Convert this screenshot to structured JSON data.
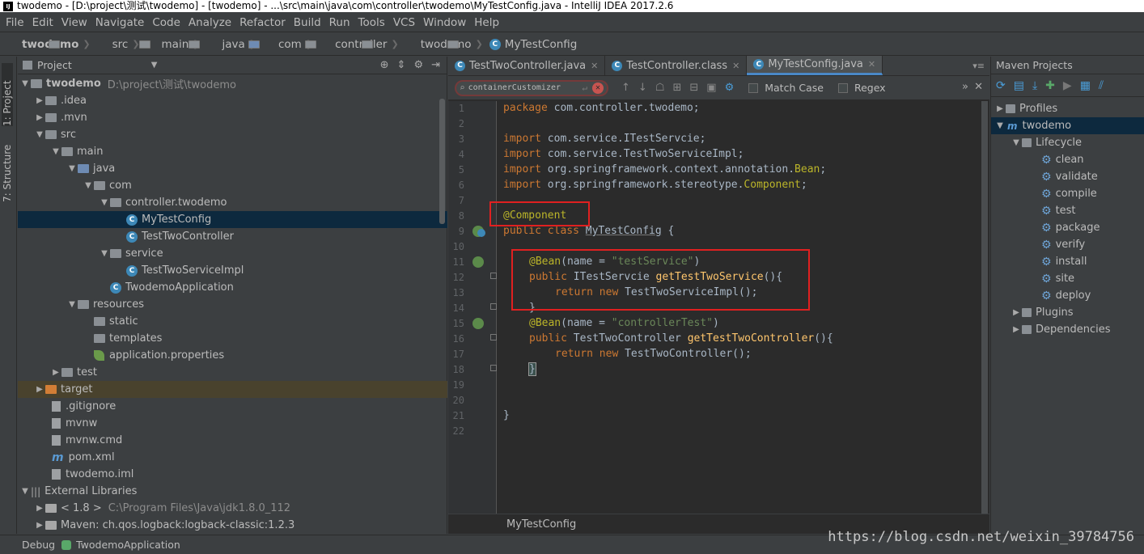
{
  "window": {
    "title": "twodemo - [D:\\project\\测试\\twodemo] - [twodemo] - ...\\src\\main\\java\\com\\controller\\twodemo\\MyTestConfig.java - IntelliJ IDEA 2017.2.6"
  },
  "menu": [
    "File",
    "Edit",
    "View",
    "Navigate",
    "Code",
    "Analyze",
    "Refactor",
    "Build",
    "Run",
    "Tools",
    "VCS",
    "Window",
    "Help"
  ],
  "breadcrumbs": [
    "twodemo",
    "src",
    "main",
    "java",
    "com",
    "controller",
    "twodemo",
    "MyTestConfig"
  ],
  "left_strip": {
    "project_tab": "1: Project",
    "structure_tab": "7: Structure"
  },
  "project_panel": {
    "title": "Project",
    "tree": [
      {
        "label": "twodemo",
        "extra": "D:\\project\\测试\\twodemo"
      },
      {
        "label": ".idea"
      },
      {
        "label": ".mvn"
      },
      {
        "label": "src"
      },
      {
        "label": "main"
      },
      {
        "label": "java"
      },
      {
        "label": "com"
      },
      {
        "label": "controller.twodemo"
      },
      {
        "label": "MyTestConfig"
      },
      {
        "label": "TestTwoController"
      },
      {
        "label": "service"
      },
      {
        "label": "TestTwoServiceImpl"
      },
      {
        "label": "TwodemoApplication"
      },
      {
        "label": "resources"
      },
      {
        "label": "static"
      },
      {
        "label": "templates"
      },
      {
        "label": "application.properties"
      },
      {
        "label": "test"
      },
      {
        "label": "target"
      },
      {
        "label": ".gitignore"
      },
      {
        "label": "mvnw"
      },
      {
        "label": "mvnw.cmd"
      },
      {
        "label": "pom.xml"
      },
      {
        "label": "twodemo.iml"
      },
      {
        "label": "External Libraries"
      },
      {
        "label": "< 1.8 >",
        "extra": "C:\\Program Files\\Java\\jdk1.8.0_112"
      },
      {
        "label": "Maven: ch.qos.logback:logback-classic:1.2.3"
      }
    ]
  },
  "editor": {
    "tabs": [
      "TestTwoController.java",
      "TestController.class",
      "MyTestConfig.java"
    ],
    "active_tab": "MyTestConfig.java",
    "search": {
      "query": "containerCustomizer",
      "match_case_label": "Match Case",
      "regex_label": "Regex"
    },
    "line_numbers": [
      "1",
      "2",
      "3",
      "4",
      "5",
      "6",
      "7",
      "8",
      "9",
      "10",
      "11",
      "12",
      "13",
      "14",
      "15",
      "16",
      "17",
      "18",
      "19",
      "20",
      "21",
      "22"
    ],
    "lines": {
      "l1_kw": "package",
      "l1_rest": " com.controller.twodemo;",
      "l3_kw": "import",
      "l3_rest": " com.service.ITestServcie;",
      "l4_kw": "import",
      "l4_rest": " com.service.TestTwoServiceImpl;",
      "l5_kw": "import",
      "l5_rest": " org.springframework.context.annotation.",
      "l5_an": "Bean",
      "l5_end": ";",
      "l6_kw": "import",
      "l6_rest": " org.springframework.stereotype.",
      "l6_an": "Component",
      "l6_end": ";",
      "l8_an": "@Component",
      "l9_kw": "public class",
      "l9_name": "MyTestConfig",
      "l9_end": " {",
      "l11_an": "@Bean",
      "l11_a": "(name = ",
      "l11_str": "\"testService\"",
      "l11_b": ")",
      "l12_kw": "public",
      "l12_type": " ITestServcie ",
      "l12_fn": "getTestTwoService",
      "l12_end": "(){",
      "l13_kw": "return new",
      "l13_rest": " TestTwoServiceImpl();",
      "l14": "}",
      "l15_an": "@Bean",
      "l15_a": "(name = ",
      "l15_str": "\"controllerTest\"",
      "l15_b": ")",
      "l16_kw": "public",
      "l16_type": " TestTwoController ",
      "l16_fn": "getTestTwoController",
      "l16_end": "(){",
      "l17_kw": "return new",
      "l17_rest": " TestTwoController();",
      "l18": "}",
      "l21": "}"
    },
    "status_label": "MyTestConfig"
  },
  "maven": {
    "title": "Maven Projects",
    "tree": [
      {
        "label": "Profiles"
      },
      {
        "label": "twodemo"
      },
      {
        "label": "Lifecycle"
      },
      {
        "label": "clean"
      },
      {
        "label": "validate"
      },
      {
        "label": "compile"
      },
      {
        "label": "test"
      },
      {
        "label": "package"
      },
      {
        "label": "verify"
      },
      {
        "label": "install"
      },
      {
        "label": "site"
      },
      {
        "label": "deploy"
      },
      {
        "label": "Plugins"
      },
      {
        "label": "Dependencies"
      }
    ]
  },
  "statusbar": {
    "debug_label": "Debug",
    "run_config": "TwodemoApplication"
  },
  "watermark": "https://blog.csdn.net/weixin_39784756",
  "colors": {
    "accent": "#4a88c7",
    "annotation_box": "#e02020",
    "selection": "#0d293e"
  }
}
